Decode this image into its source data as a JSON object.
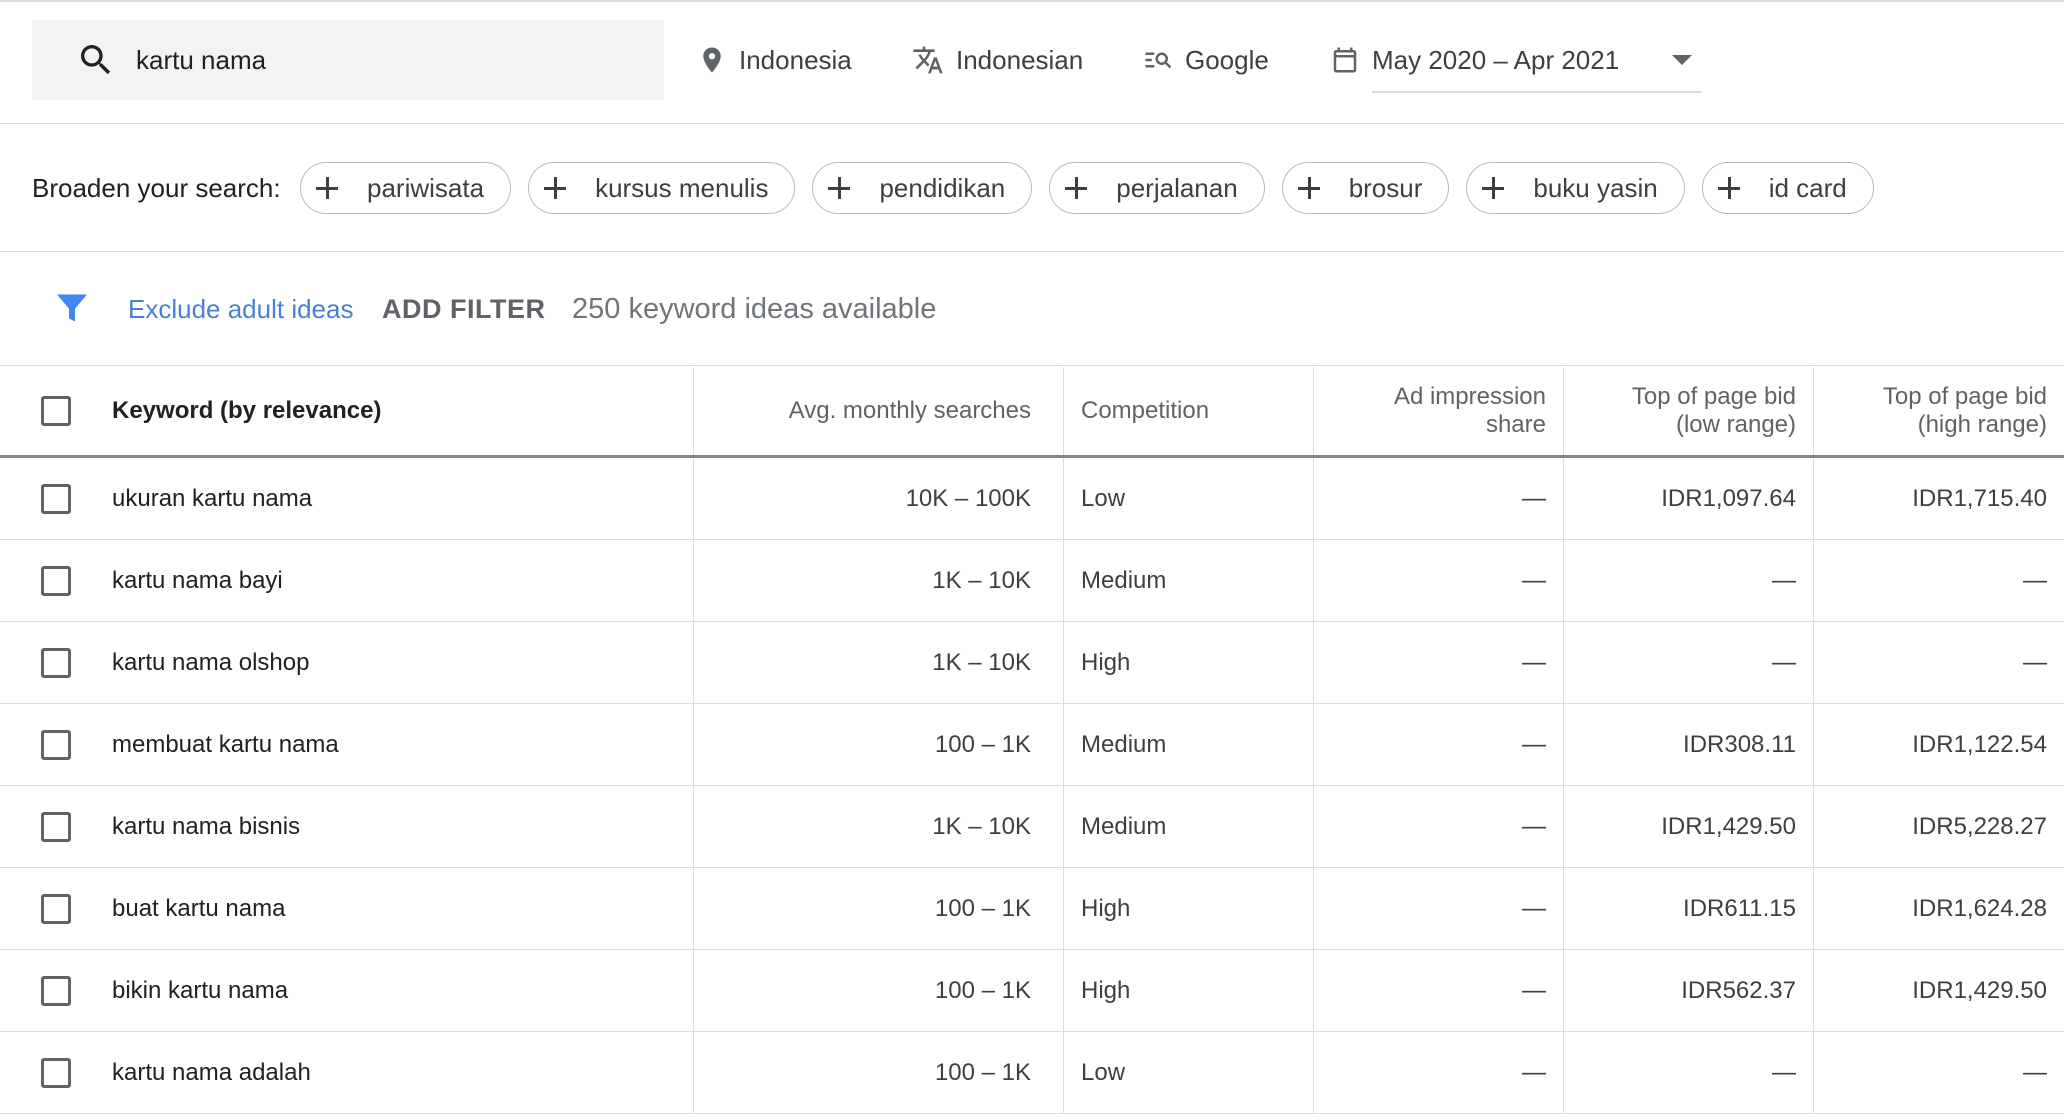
{
  "search": {
    "query": "kartu nama"
  },
  "location": "Indonesia",
  "language": "Indonesian",
  "network": "Google",
  "date_range": "May 2020 – Apr 2021",
  "broaden": {
    "label": "Broaden your search:",
    "chips": [
      "pariwisata",
      "kursus menulis",
      "pendidikan",
      "perjalanan",
      "brosur",
      "buku yasin",
      "id card"
    ]
  },
  "filters": {
    "exclude_adult": "Exclude adult ideas",
    "add_filter": "ADD FILTER",
    "count_text": "250 keyword ideas available"
  },
  "table": {
    "headers": {
      "keyword": "Keyword (by relevance)",
      "avg": "Avg. monthly searches",
      "competition": "Competition",
      "impression_line1": "Ad impression",
      "impression_line2": "share",
      "low_line1": "Top of page bid",
      "low_line2": "(low range)",
      "high_line1": "Top of page bid",
      "high_line2": "(high range)"
    },
    "rows": [
      {
        "keyword": "ukuran kartu nama",
        "avg": "10K – 100K",
        "competition": "Low",
        "impression": "—",
        "low": "IDR1,097.64",
        "high": "IDR1,715.40"
      },
      {
        "keyword": "kartu nama bayi",
        "avg": "1K – 10K",
        "competition": "Medium",
        "impression": "—",
        "low": "—",
        "high": "—"
      },
      {
        "keyword": "kartu nama olshop",
        "avg": "1K – 10K",
        "competition": "High",
        "impression": "—",
        "low": "—",
        "high": "—"
      },
      {
        "keyword": "membuat kartu nama",
        "avg": "100 – 1K",
        "competition": "Medium",
        "impression": "—",
        "low": "IDR308.11",
        "high": "IDR1,122.54"
      },
      {
        "keyword": "kartu nama bisnis",
        "avg": "1K – 10K",
        "competition": "Medium",
        "impression": "—",
        "low": "IDR1,429.50",
        "high": "IDR5,228.27"
      },
      {
        "keyword": "buat kartu nama",
        "avg": "100 – 1K",
        "competition": "High",
        "impression": "—",
        "low": "IDR611.15",
        "high": "IDR1,624.28"
      },
      {
        "keyword": "bikin kartu nama",
        "avg": "100 – 1K",
        "competition": "High",
        "impression": "—",
        "low": "IDR562.37",
        "high": "IDR1,429.50"
      },
      {
        "keyword": "kartu nama adalah",
        "avg": "100 – 1K",
        "competition": "Low",
        "impression": "—",
        "low": "—",
        "high": "—"
      }
    ]
  },
  "colors": {
    "link": "#4a80d4",
    "filter_icon": "#4285f4",
    "surface": "#f1f3f4"
  },
  "icons": [
    "search-icon",
    "location-pin-icon",
    "translate-icon",
    "search-network-icon",
    "calendar-icon",
    "dropdown-caret-icon",
    "plus-icon",
    "filter-funnel-icon",
    "checkbox-icon"
  ]
}
